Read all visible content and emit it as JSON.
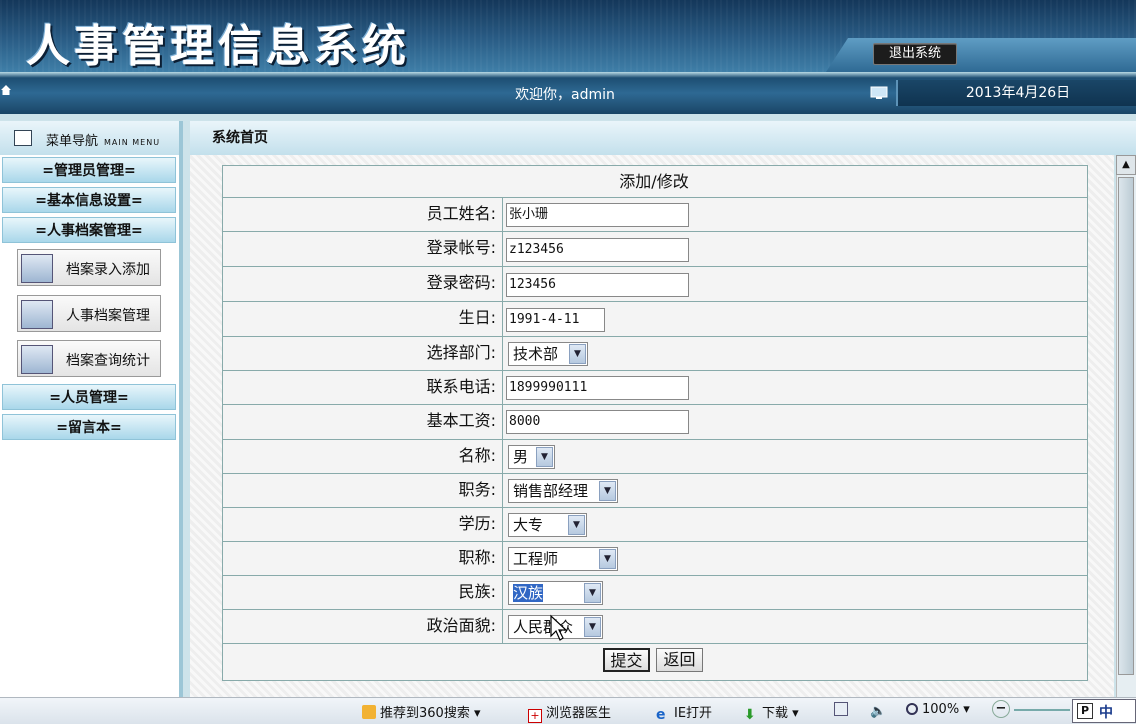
{
  "header": {
    "title": "人事管理信息系统",
    "logout_label": "退出系统"
  },
  "topbar": {
    "welcome": "欢迎你，admin",
    "date": "2013年4月26日"
  },
  "sidebar": {
    "title": "菜单导航",
    "title_en": "MAIN MENU",
    "categories": [
      "=管理员管理=",
      "=基本信息设置=",
      "=人事档案管理=",
      "=人员管理=",
      "=留言本="
    ],
    "items": [
      "档案录入添加",
      "人事档案管理",
      "档案查询统计"
    ]
  },
  "content": {
    "breadcrumb": "系统首页"
  },
  "form": {
    "title": "添加/修改",
    "fields": [
      {
        "label": "员工姓名:",
        "value": "张小珊"
      },
      {
        "label": "登录帐号:",
        "value": "z123456"
      },
      {
        "label": "登录密码:",
        "value": "123456"
      },
      {
        "label": "生日:",
        "value": "1991-4-11"
      },
      {
        "label": "选择部门:",
        "value": "技术部"
      },
      {
        "label": "联系电话:",
        "value": "1899990111"
      },
      {
        "label": "基本工资:",
        "value": "8000"
      },
      {
        "label": "名称:",
        "value": "男"
      },
      {
        "label": "职务:",
        "value": "销售部经理"
      },
      {
        "label": "学历:",
        "value": "大专"
      },
      {
        "label": "职称:",
        "value": "工程师"
      },
      {
        "label": "民族:",
        "value": "汉族"
      },
      {
        "label": "政治面貌:",
        "value": "人民群众"
      }
    ],
    "submit_label": "提交",
    "back_label": "返回"
  },
  "statusbar": {
    "items": [
      "推荐到360搜索",
      "浏览器医生",
      "IE打开",
      "下载",
      "100%"
    ],
    "ime": "中"
  },
  "colors": {
    "header_dark": "#14375a",
    "sidebar_category": "#a9d7ea",
    "selection": "#3167c4"
  },
  "icons": [
    "home-icon",
    "monitor-icon",
    "menu-icon",
    "user-card-icon",
    "scroll-up-icon",
    "dropdown-arrow-icon",
    "bookmark-icon",
    "first-aid-icon",
    "ie-icon",
    "download-icon",
    "speaker-icon",
    "zoom-icon"
  ]
}
